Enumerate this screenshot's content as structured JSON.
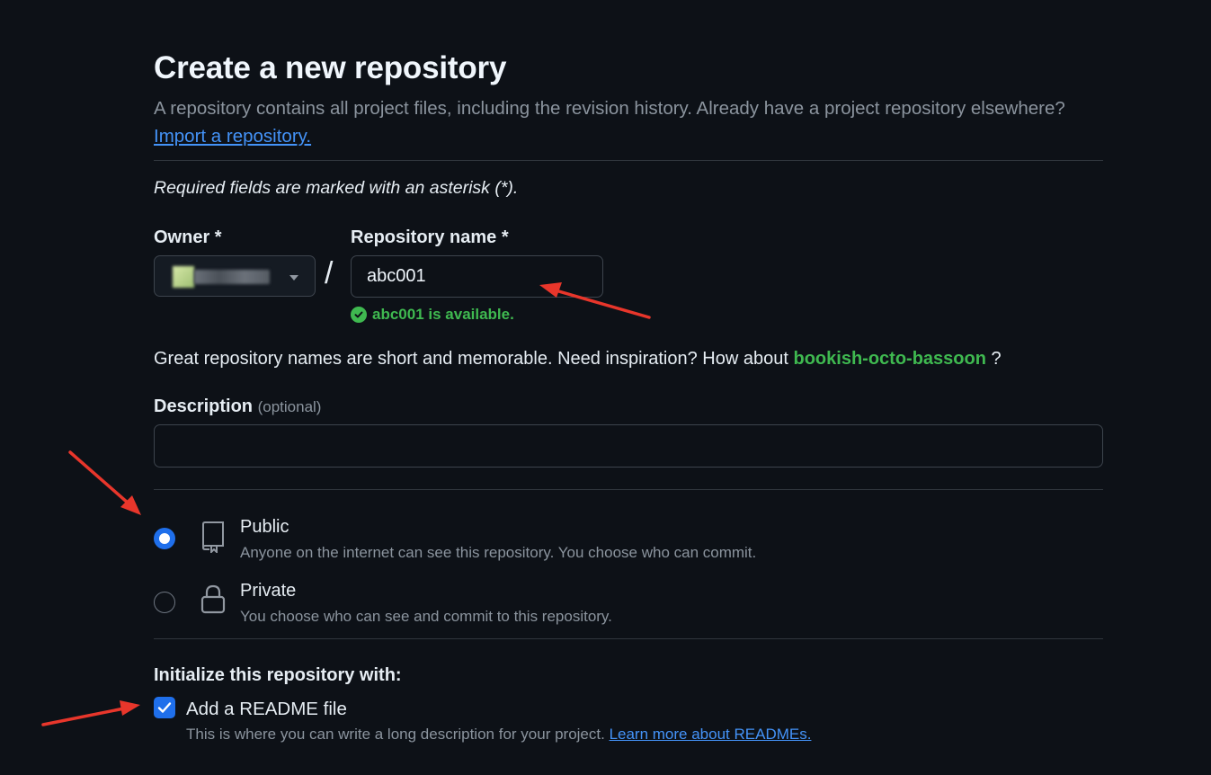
{
  "header": {
    "title": "Create a new repository",
    "subtitle": "A repository contains all project files, including the revision history. Already have a project repository elsewhere?",
    "import_link": "Import a repository."
  },
  "form": {
    "required_note": "Required fields are marked with an asterisk (*).",
    "owner_label": "Owner *",
    "repo_name_label": "Repository name *",
    "slash": "/",
    "repo_name_value": "abc001",
    "availability": "abc001 is available.",
    "hint_prefix": "Great repository names are short and memorable. Need inspiration? How about",
    "suggestion": "bookish-octo-bassoon",
    "hint_suffix": "?",
    "description_label": "Description",
    "description_optional": "(optional)",
    "description_value": ""
  },
  "visibility": {
    "selected": "Public",
    "options": [
      {
        "title": "Public",
        "description": "Anyone on the internet can see this repository. You choose who can commit."
      },
      {
        "title": "Private",
        "description": "You choose who can see and commit to this repository."
      }
    ]
  },
  "initialize": {
    "heading": "Initialize this repository with:",
    "readme_label": "Add a README file",
    "readme_checked": true,
    "readme_description": "This is where you can write a long description for your project.",
    "readme_link": "Learn more about READMEs."
  },
  "icons": {
    "public": "repo-icon",
    "private": "lock-icon",
    "available": "check-circle-icon",
    "owner_dropdown": "caret-down-icon"
  },
  "colors": {
    "background": "#0d1117",
    "accent": "#1f6feb",
    "success": "#3fb950",
    "link": "#4493f8",
    "annotation_arrow": "#e8362b"
  }
}
